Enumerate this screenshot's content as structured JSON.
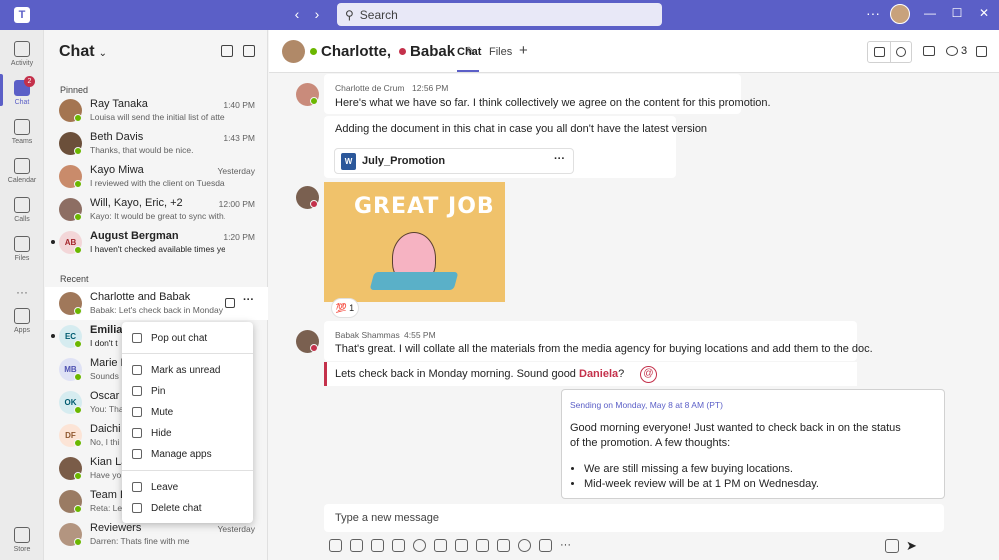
{
  "title_bar": {
    "logo_icon": "teams-logo-icon",
    "search_placeholder": "Search",
    "more_label": "···",
    "minimize_label": "—",
    "maximize_label": "☐",
    "close_label": "✕"
  },
  "rail": {
    "items": [
      {
        "label": "Activity",
        "icon": "bell-icon"
      },
      {
        "label": "Chat",
        "icon": "chat-icon",
        "active": true,
        "badge": "2"
      },
      {
        "label": "Teams",
        "icon": "teams-icon"
      },
      {
        "label": "Calendar",
        "icon": "calendar-icon"
      },
      {
        "label": "Calls",
        "icon": "phone-icon"
      },
      {
        "label": "Files",
        "icon": "file-icon"
      },
      {
        "label": "···",
        "icon": "more-icon"
      },
      {
        "label": "Apps",
        "icon": "apps-icon"
      }
    ],
    "store_label": "Store"
  },
  "chat_list": {
    "title": "Chat",
    "pinned_label": "Pinned",
    "recent_label": "Recent",
    "pinned": [
      {
        "name": "Ray Tanaka",
        "preview": "Louisa will send the initial list of atte...",
        "time": "1:40 PM",
        "av_color": "#a47551"
      },
      {
        "name": "Beth Davis",
        "preview": "Thanks, that would be nice.",
        "time": "1:43 PM",
        "av_color": "#6b4f3a"
      },
      {
        "name": "Kayo Miwa",
        "preview": "I reviewed with the client on Tuesda...",
        "time": "Yesterday",
        "av_color": "#c98b6b"
      },
      {
        "name": "Will, Kayo, Eric, +2",
        "preview": "Kayo: It would be great to sync with...",
        "time": "12:00 PM",
        "av_color": "#8d6e63"
      },
      {
        "name": "August Bergman",
        "preview": "I haven't checked available times yet",
        "time": "1:20 PM",
        "initials": "AB",
        "av_color": "#f3d6d8",
        "initials_color": "#a4262c",
        "unread": true
      }
    ],
    "recent": [
      {
        "name": "Charlotte and Babak",
        "preview": "Babak: Let's check back in Monday",
        "time": "",
        "av_color": "#a0785a",
        "selected": true
      },
      {
        "name": "Emilian",
        "preview": "I don't t",
        "time": "",
        "initials": "EC",
        "av_color": "#d6ecf0",
        "initials_color": "#005b70",
        "unread": true
      },
      {
        "name": "Marie B",
        "preview": "Sounds",
        "time": "",
        "initials": "MB",
        "av_color": "#dfe2f5",
        "initials_color": "#4f52b2"
      },
      {
        "name": "Oscar K",
        "preview": "You: Tha",
        "time": "",
        "initials": "OK",
        "av_color": "#d6ecf0",
        "initials_color": "#005b70"
      },
      {
        "name": "Daichi",
        "preview": "No, I thi",
        "time": "",
        "initials": "DF",
        "av_color": "#fce4d6",
        "initials_color": "#8e562e"
      },
      {
        "name": "Kian La",
        "preview": "Have yo",
        "time": "",
        "av_color": "#7a5c48"
      },
      {
        "name": "Team D",
        "preview": "Reta: Le",
        "time": "",
        "av_color": "#9a7b63"
      },
      {
        "name": "Reviewers",
        "preview": "Darren: Thats fine with me",
        "time": "Yesterday",
        "av_color": "#b39580"
      }
    ]
  },
  "context_menu": {
    "pop_out": "Pop out chat",
    "mark_unread": "Mark as unread",
    "pin": "Pin",
    "mute": "Mute",
    "hide": "Hide",
    "manage_apps": "Manage apps",
    "leave": "Leave",
    "delete": "Delete chat"
  },
  "chat_header": {
    "name1": "Charlotte,",
    "name2": "Babak",
    "tab_chat": "Chat",
    "tab_files": "Files",
    "people_count": "3"
  },
  "messages": {
    "m1_author": "Charlotte de Crum",
    "m1_time": "12:56 PM",
    "m1_text": "Here's what we have so far. I think collectively we agree on the content for this promotion.",
    "m2_text": "Adding the document in this chat in case you all don't have the latest version",
    "file_name": "July_Promotion",
    "gif_text": "GREAT JOB",
    "reaction_count": "1",
    "m3_author": "Babak Shammas",
    "m3_time": "4:55 PM",
    "m3_text": "That's great. I will collate all the materials from the media agency for buying locations and add them to the doc.",
    "quote_text": "Lets check back in Monday morning. Sound good",
    "quote_mention": "Daniela",
    "quote_end": "?"
  },
  "scheduled": {
    "label": "Sending on Monday, May 8 at 8 AM (PT)",
    "text": "Good morning everyone! Just wanted to check back in on the status of the promotion. A few thoughts:",
    "bullet1": "We are still missing a few buying locations.",
    "bullet2": "Mid-week review will be at 1 PM on Wednesday."
  },
  "compose": {
    "placeholder": "Type a new message"
  },
  "colors": {
    "brand": "#5b5fc7",
    "available": "#6bb700",
    "busy": "#c4314b"
  }
}
